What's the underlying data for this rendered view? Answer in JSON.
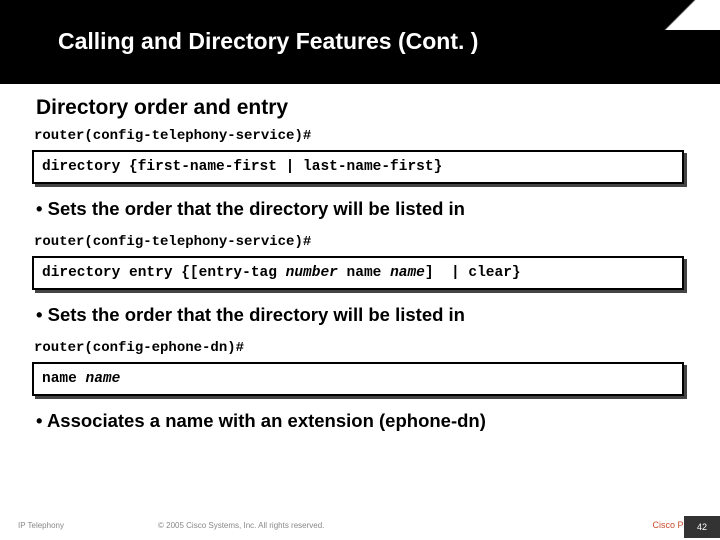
{
  "header": {
    "title": "Calling and Directory Features (Cont. )"
  },
  "subtitle": "Directory order and entry",
  "blocks": [
    {
      "prompt": "router(config-telephony-service)#",
      "cmd_parts": [
        "directory {first-name-first | last-name-first}"
      ],
      "bullet": "Sets the order that the directory will be listed in"
    },
    {
      "prompt": "router(config-telephony-service)#",
      "cmd_parts": [
        "directory entry {[entry-tag ",
        {
          "i": "number"
        },
        " name ",
        {
          "i": "name"
        },
        "]  | clear}"
      ],
      "bullet": "Sets the order that the directory will be listed in"
    },
    {
      "prompt": "router(config-ephone-dn)#",
      "cmd_parts": [
        "name ",
        {
          "i": "name"
        }
      ],
      "bullet": "Associates a name with an extension (ephone-dn)"
    }
  ],
  "footer": {
    "tag": "IP Telephony",
    "copy": "© 2005 Cisco Systems, Inc. All rights reserved.",
    "pub": "Cisco Public",
    "page": "42"
  }
}
